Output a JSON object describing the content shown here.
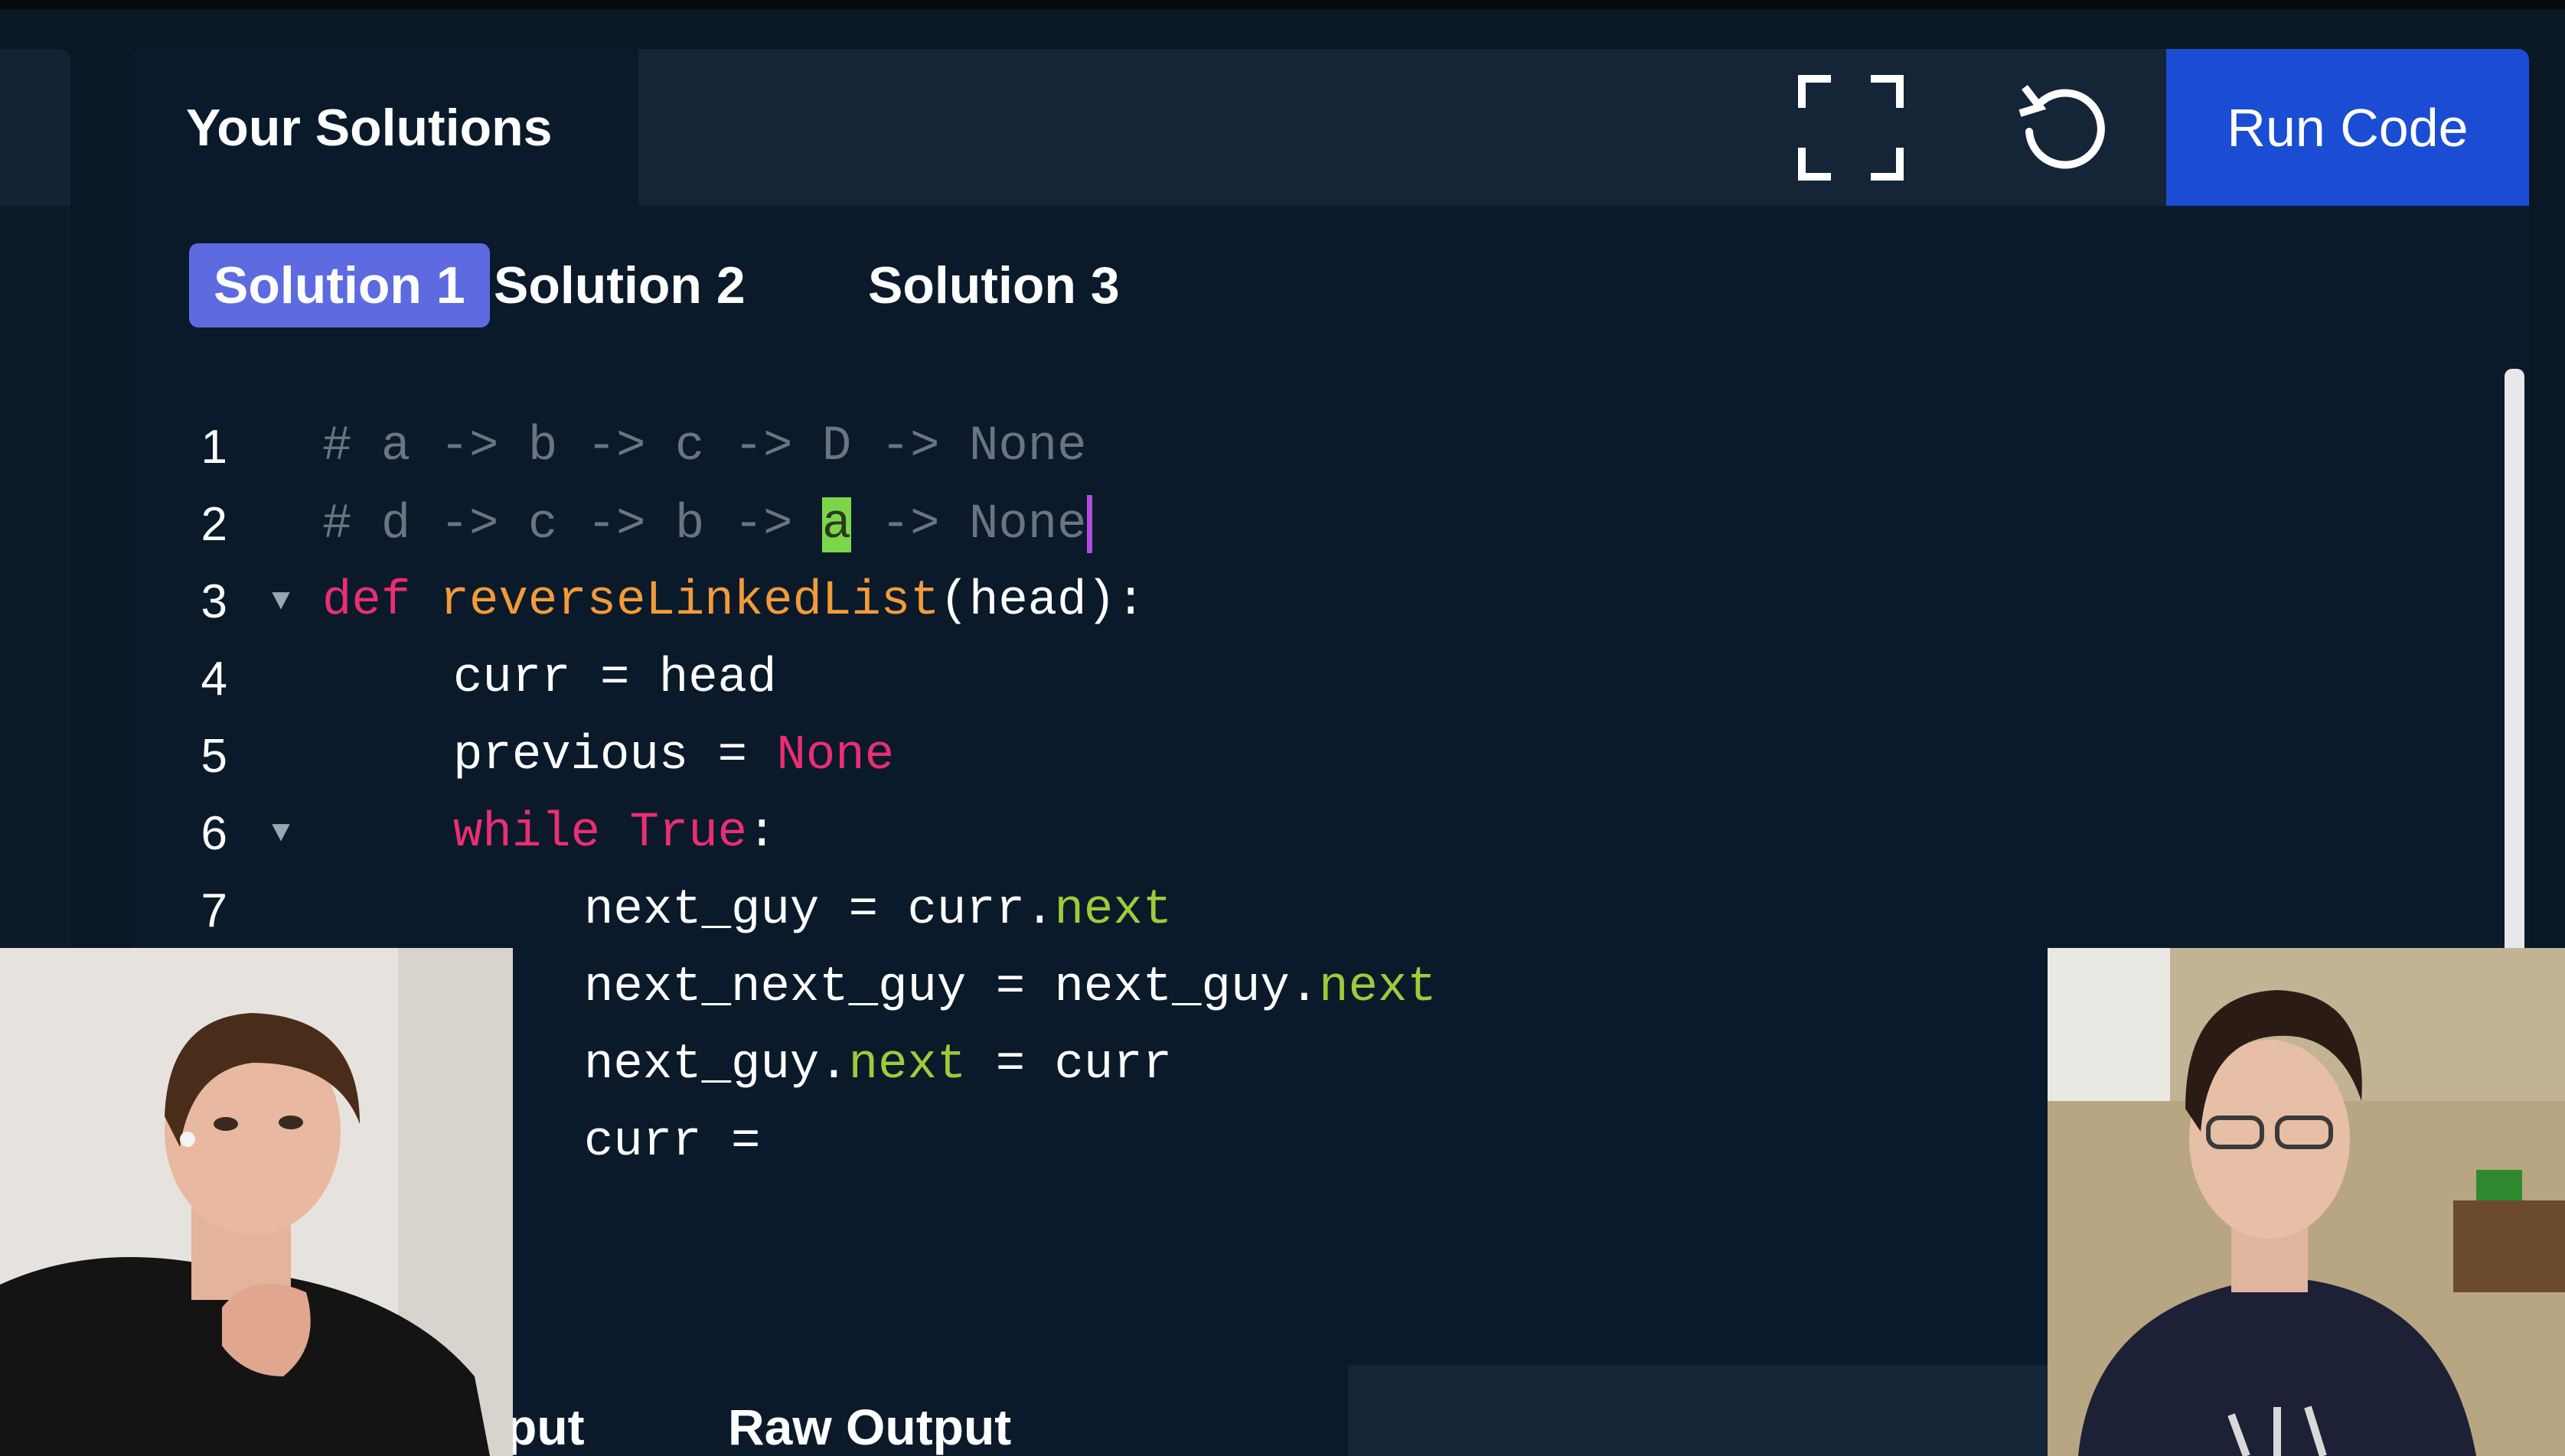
{
  "header": {
    "title": "Your Solutions",
    "run_label": "Run Code",
    "fullscreen_icon": "fullscreen-icon",
    "reset_icon": "reset-icon"
  },
  "tabs": [
    {
      "label": "Solution 1",
      "active": true
    },
    {
      "label": "Solution 2",
      "active": false
    },
    {
      "label": "Solution 3",
      "active": false
    }
  ],
  "code": {
    "line_numbers": [
      "1",
      "2",
      "3",
      "4",
      "5",
      "6",
      "7"
    ],
    "lines": [
      {
        "comment_prefix": "# a -> b -> c -> ",
        "comment_D": "D",
        "comment_suffix": " -> None"
      },
      {
        "comment_prefix": "# d -> c -> b -> ",
        "highlight": "a",
        "comment_suffix": " -> None"
      },
      {
        "kw": "def",
        "fn": "reverseLinkedList",
        "rest": "(head):"
      },
      {
        "text": "curr = head"
      },
      {
        "text": "previous = ",
        "kw": "None"
      },
      {
        "kw1": "while",
        "kw2": "True",
        "rest": ":"
      },
      {
        "text": "next_guy = curr.",
        "attr": "next"
      },
      {
        "text": "next_next_guy = next_guy.",
        "attr": "next"
      },
      {
        "pre": "next_guy.",
        "attr": "next",
        "post": " = curr"
      },
      {
        "text": "curr ="
      }
    ]
  },
  "bottom_tabs": [
    "put",
    "Raw Output"
  ],
  "colors": {
    "background": "#0a1724",
    "run_button": "#1a4dd3",
    "active_tab": "#5d6ae0",
    "keyword": "#ea2e72",
    "function": "#f29b3a",
    "attribute": "#9ccc3a",
    "comment": "#6b7480"
  }
}
